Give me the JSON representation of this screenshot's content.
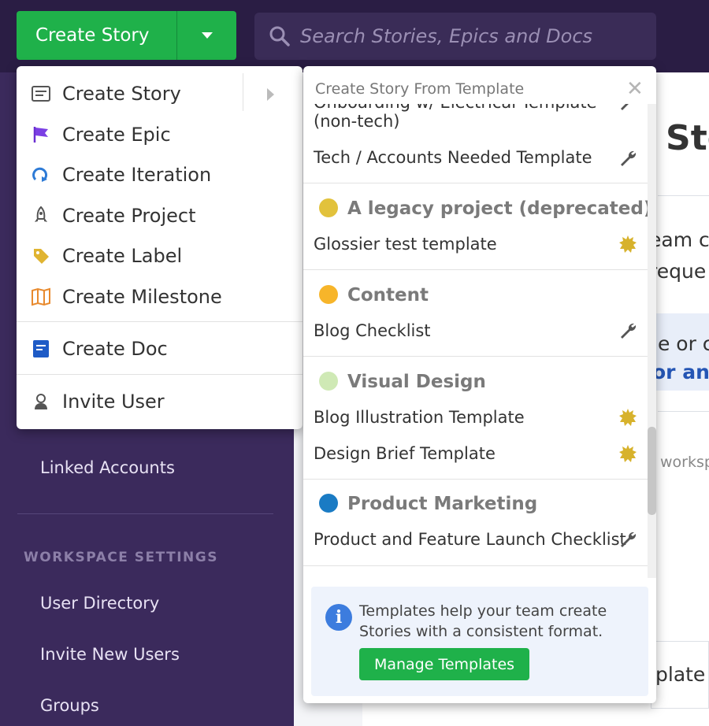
{
  "topbar": {
    "create_label": "Create Story",
    "search_placeholder": "Search Stories, Epics and Docs"
  },
  "sidebar": {
    "items": [
      "Linked Accounts",
      "User Directory",
      "Invite New Users",
      "Groups"
    ],
    "section_heading": "WORKSPACE SETTINGS"
  },
  "dropdown": {
    "items": [
      {
        "label": "Create Story",
        "icon": "story-icon"
      },
      {
        "label": "Create Epic",
        "icon": "epic-flag-icon"
      },
      {
        "label": "Create Iteration",
        "icon": "iteration-icon"
      },
      {
        "label": "Create Project",
        "icon": "rocket-icon"
      },
      {
        "label": "Create Label",
        "icon": "tag-icon"
      },
      {
        "label": "Create Milestone",
        "icon": "map-icon"
      },
      {
        "label": "Create Doc",
        "icon": "doc-icon"
      },
      {
        "label": "Invite User",
        "icon": "user-icon"
      }
    ]
  },
  "template_panel": {
    "header": "Create Story From Template",
    "partial_top": "Onboarding w/ Electrical Template",
    "partial_top_line2": "(non-tech)",
    "rows": [
      {
        "label": "Tech / Accounts Needed Template",
        "icon": "wrench-icon"
      }
    ],
    "groups": [
      {
        "name": "A legacy project (deprecated)",
        "color": "#e2c23c",
        "templates": [
          {
            "label": "Glossier test template",
            "icon": "feature-star-icon"
          }
        ]
      },
      {
        "name": "Content",
        "color": "#f7b52a",
        "templates": [
          {
            "label": "Blog Checklist",
            "icon": "wrench-icon"
          }
        ]
      },
      {
        "name": "Visual Design",
        "color": "#cfe9b5",
        "templates": [
          {
            "label": "Blog Illustration Template",
            "icon": "feature-star-icon"
          },
          {
            "label": "Design Brief Template",
            "icon": "feature-star-icon"
          }
        ]
      },
      {
        "name": "Product Marketing",
        "color": "#1a7bc4",
        "templates": [
          {
            "label": "Product and Feature Launch Checklist",
            "icon": "wrench-icon"
          }
        ]
      }
    ],
    "footer_text": "Templates help your team create Stories with a consistent format.",
    "manage_label": "Manage Templates"
  },
  "background": {
    "title": "Sto",
    "text1": "eam c",
    "text2": "reque",
    "text3": "le or c",
    "text4": "or an",
    "text5": "worksp",
    "text6": "plate"
  },
  "colors": {
    "brand_green": "#1fb14a",
    "topbar": "#2a1d44",
    "sidebar": "#3b2a5c",
    "info_blue": "#3c7cde"
  }
}
